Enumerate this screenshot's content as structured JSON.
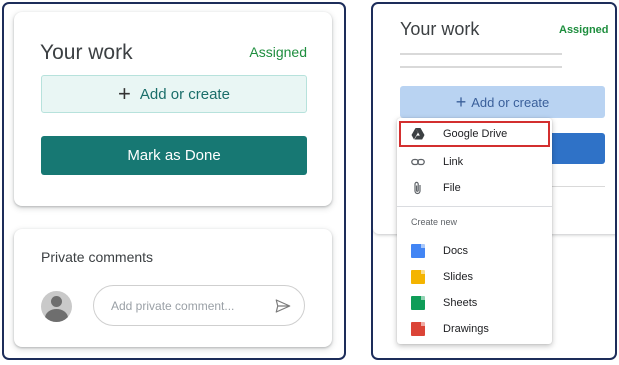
{
  "left_panel": {
    "work_card": {
      "title": "Your work",
      "status": "Assigned",
      "add_create_label": "Add or create",
      "mark_done_label": "Mark as Done"
    },
    "comments_card": {
      "title": "Private comments",
      "input_placeholder": "Add private comment..."
    }
  },
  "right_panel": {
    "title": "Your work",
    "status": "Assigned",
    "add_create_label": "Add or create",
    "menu": {
      "items": [
        {
          "label": "Google Drive",
          "icon": "google-drive-icon",
          "highlighted": true
        },
        {
          "label": "Link",
          "icon": "link-icon"
        },
        {
          "label": "File",
          "icon": "paperclip-icon"
        }
      ],
      "section_label": "Create new",
      "create_items": [
        {
          "label": "Docs",
          "icon": "docs-icon",
          "color": "#4285f4"
        },
        {
          "label": "Slides",
          "icon": "slides-icon",
          "color": "#f4b400"
        },
        {
          "label": "Sheets",
          "icon": "sheets-icon",
          "color": "#0f9d58"
        },
        {
          "label": "Drawings",
          "icon": "drawings-icon",
          "color": "#db4437"
        }
      ]
    }
  },
  "colors": {
    "panel_border": "#1d2d5a",
    "assigned_green": "#1e8e3e",
    "mark_done_teal": "#177873",
    "highlight_red": "#d32f2f",
    "right_add_button": "#b9d3f2",
    "right_blue_button": "#2f72c7"
  }
}
